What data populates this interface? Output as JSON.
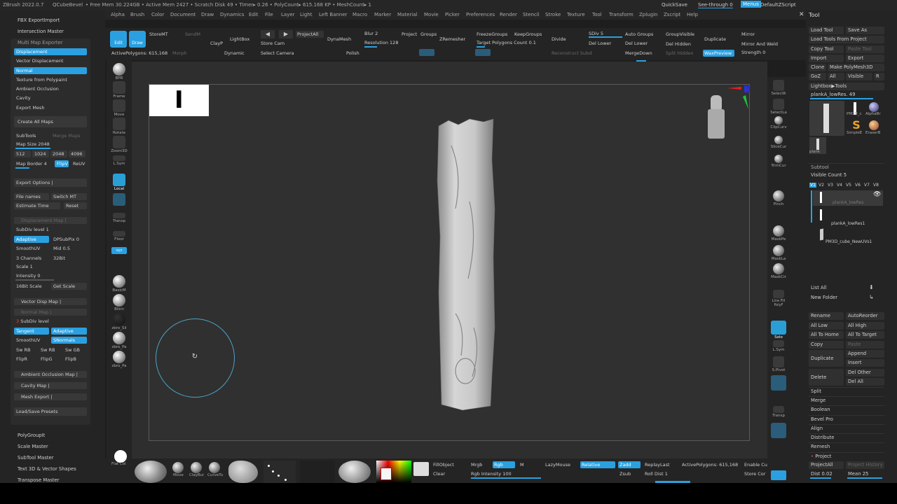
{
  "titlebar": {
    "app": "ZBrush 2022.0.7",
    "plugin": "QCubeBevel",
    "stats": "• Free Mem 30.224GB • Active Mem 2427 • Scratch Disk 49 • Timer▸ 0.26 • PolyCount▸ 615.168 KP • MeshCount▸ 1",
    "quicksave": "QuickSave",
    "seethrough": "See-through  0",
    "menus": "Menus",
    "script": "DefaultZScript"
  },
  "menubar": [
    "Alpha",
    "Brush",
    "Color",
    "Document",
    "Draw",
    "Dynamics",
    "Edit",
    "File",
    "Layer",
    "Light",
    "Left Banner",
    "Macro",
    "Marker",
    "Material",
    "Movie",
    "Picker",
    "Preferences",
    "Render",
    "Stencil",
    "Stroke",
    "Texture",
    "Tool",
    "Transform",
    "Zplugin",
    "Zscript",
    "Help"
  ],
  "left": {
    "fbx": "FBX ExportImport",
    "intersection": "Intersection Master",
    "multimap": "Multi Map Exporter",
    "displacement": "Displacement",
    "vector_disp": "Vector Displacement",
    "normal": "Normal",
    "texture_poly": "Texture from Polypaint",
    "ao": "Ambient Occlusion",
    "cavity": "Cavity",
    "export_mesh": "Export Mesh",
    "create_all": "Create All Maps",
    "subtools": "SubTools",
    "merge_maps": "Merge Maps",
    "map_size": "Map Size",
    "map_size_val": "2048",
    "sizes": [
      "512",
      "1024",
      "2048",
      "4096"
    ],
    "map_border": "Map Border",
    "map_border_val": "4",
    "flipv": "FlipV",
    "reuv": "ReUV",
    "export_options": "Export Options  |",
    "file_names": "File names",
    "switch_mt": "Switch MT",
    "estimate_time": "Estimate Time",
    "reset": "Reset",
    "disp_map": "Displacement Map  |",
    "subdiv_level": "SubDiv level",
    "subdiv_val": "1",
    "adaptive": "Adaptive",
    "dpsubpix": "DPSubPix",
    "dpsubpix_val": "0",
    "smoothuv": "SmoothUV",
    "mid": "Mid",
    "mid_val": "0.5",
    "channels": "3 Channels",
    "bit32": "32Bit",
    "scale": "Scale",
    "scale_val": "1",
    "intensity": "Intensity",
    "intensity_val": "0",
    "bit16": "16Bit Scale",
    "get_scale": "Get Scale",
    "vector_map": "Vector Disp Map  |",
    "normal_map": "Normal Map  |",
    "subdiv2": "SubDiv level",
    "subdiv2_val": "3",
    "tangent": "Tangent",
    "adaptive2": "Adaptive",
    "smoothuv2": "SmoothUV",
    "snormals": "SNormals",
    "swrb": "Sw RB",
    "swrb2": "Sw RB",
    "swgb": "Sw GB",
    "flipr": "FlipR",
    "flipg": "FlipG",
    "flipb": "FlipB",
    "ao_map": "Ambient Occlusion Map  |",
    "cavity_map": "Cavity Map  |",
    "mesh_export": "Mesh Export  |",
    "load_save": "Load/Save Presets",
    "polygroupit": "PolyGroupIt",
    "scale_master": "Scale Master",
    "subtool_master": "SubTool Master",
    "text3d": "Text 3D & Vector Shapes",
    "transpose_master": "Transpose Master"
  },
  "toolbar": {
    "edit": "Edit",
    "draw": "Draw",
    "storemt": "StoreMT",
    "sendmt": "SendM",
    "lightbox": "LightBox",
    "clayp": "ClayP",
    "dynamic": "Dynamic",
    "projectall": "ProjectAll",
    "storecam": "Store Cam",
    "selectcam": "Select Camera",
    "dynamesh": "DynaMesh",
    "blur": "Blur",
    "blur_val": "2",
    "project": "Project",
    "groups": "Groups",
    "resolution": "Resolution",
    "resolution_val": "128",
    "polish": "Polish",
    "zremesher": "ZRemesher",
    "freezegroups": "FreezeGroups",
    "keepgroups": "KeepGroups",
    "target_poly": "Target Polygons Count",
    "target_poly_val": "0.1",
    "divide": "Divide",
    "sdiv": "SDiv",
    "sdiv_val": "5",
    "dellower": "Del Lower",
    "delhigher": "Del Higher",
    "autogroups": "Auto Groups",
    "groupvisible": "GroupVisible",
    "duplicate": "Duplicate",
    "mergedown": "MergeDown",
    "delhidden": "Del Hidden",
    "splithidden": "Split Hidden",
    "mirror": "Mirror",
    "mirrorweld": "Mirror And Weld",
    "waxpreview": "WaxPreview",
    "strength": "Strength",
    "strength_val": "0",
    "active_polys": "ActivePolygons: 615,168",
    "morph": "Morph",
    "reconstruct": "Reconstruct Subdiv",
    "subdivision": "Subdivision"
  },
  "leftshelf": [
    "BPR",
    "Frame",
    "Move",
    "Rotate",
    "Zoom3D",
    "L.Sym",
    "Local",
    "",
    "Transp",
    "Floor",
    "",
    "BasicM",
    "Blinn",
    "zbro_Sil",
    "zbro_Pa",
    "zbro_Pa"
  ],
  "rightshelf": [
    "SelectR",
    "SelectLa",
    "ClipCurv",
    "SliceCur",
    "TrimCur",
    "Pinch",
    "MaskPe",
    "MaskLa",
    "MaskCir",
    "Line Fill PolyF",
    "Solo",
    "L.Sym",
    "S.Pivot",
    "",
    "Transp"
  ],
  "rightpanel": {
    "title": "Tool",
    "load_tool": "Load Tool",
    "save_as": "Save As",
    "load_tools_project": "Load Tools From Project",
    "copy_tool": "Copy Tool",
    "paste_tool": "Paste Tool",
    "import": "Import",
    "export": "Export",
    "clone": "Clone",
    "make_polymesh": "Make PolyMesh3D",
    "goz": "GoZ",
    "all": "All",
    "visible": "Visible",
    "r": "R",
    "lightbox_tools": "Lightbox▶Tools",
    "plank_name": "plankA_lowRes.",
    "plank_num": "49",
    "thumb_labels": [
      "PM3D_c",
      "AlphaBr",
      "SimpleE",
      "EraserB",
      "plank"
    ],
    "subtool": "Subtool",
    "visible_count": "Visible Count",
    "visible_count_val": "5",
    "vtabs": [
      "V1",
      "V2",
      "V3",
      "V4",
      "V5",
      "V6",
      "V7",
      "V8"
    ],
    "st_items": [
      "plankA_lowRes",
      "plankA_lowRes1",
      "PM3D_cube_NewUVs1"
    ],
    "list_all": "List All",
    "new_folder": "New Folder",
    "rename": "Rename",
    "autoreorder": "AutoReorder",
    "all_low": "All Low",
    "all_high": "All High",
    "all_home": "All To Home",
    "all_target": "All To Target",
    "copy": "Copy",
    "paste": "Paste",
    "duplicate": "Duplicate",
    "append": "Append",
    "insert": "Insert",
    "delete": "Delete",
    "del_other": "Del Other",
    "del_all": "Del All",
    "split": "Split",
    "merge": "Merge",
    "boolean": "Boolean",
    "bevel_pro": "Bevel Pro",
    "align": "Align",
    "distribute": "Distribute",
    "remesh": "Remesh",
    "project": "Project",
    "projectall": "ProjectAll",
    "project_history": "Project History",
    "dist": "Dist",
    "dist_val": "0.02",
    "mean": "Mean",
    "mean_val": "25"
  },
  "bottombar": {
    "flatcol": "Flat Col",
    "move": "Move",
    "claybui": "ClayBui",
    "curvetu": "CurveTu",
    "fillobject": "FillObject",
    "clear": "Clear",
    "mrgb": "Mrgb",
    "rgb": "Rgb",
    "m": "M",
    "rgb_intensity": "Rgb Intensity",
    "rgb_intensity_val": "100",
    "lazymouse": "LazyMouse",
    "relative": "Relative",
    "zadd": "Zadd",
    "zsub": "Zsub",
    "replaylast": "ReplayLast",
    "roll_dist": "Roll Dist",
    "roll_dist_val": "1",
    "active_polys": "ActivePolygons: 615,168",
    "enable_cu": "Enable Cu",
    "store_co": "Store Cor"
  },
  "canvas": {
    "overlay_char": "I"
  },
  "colors": {
    "accent": "#2aa0e0",
    "panel": "#242424",
    "viewport": "#303030"
  }
}
